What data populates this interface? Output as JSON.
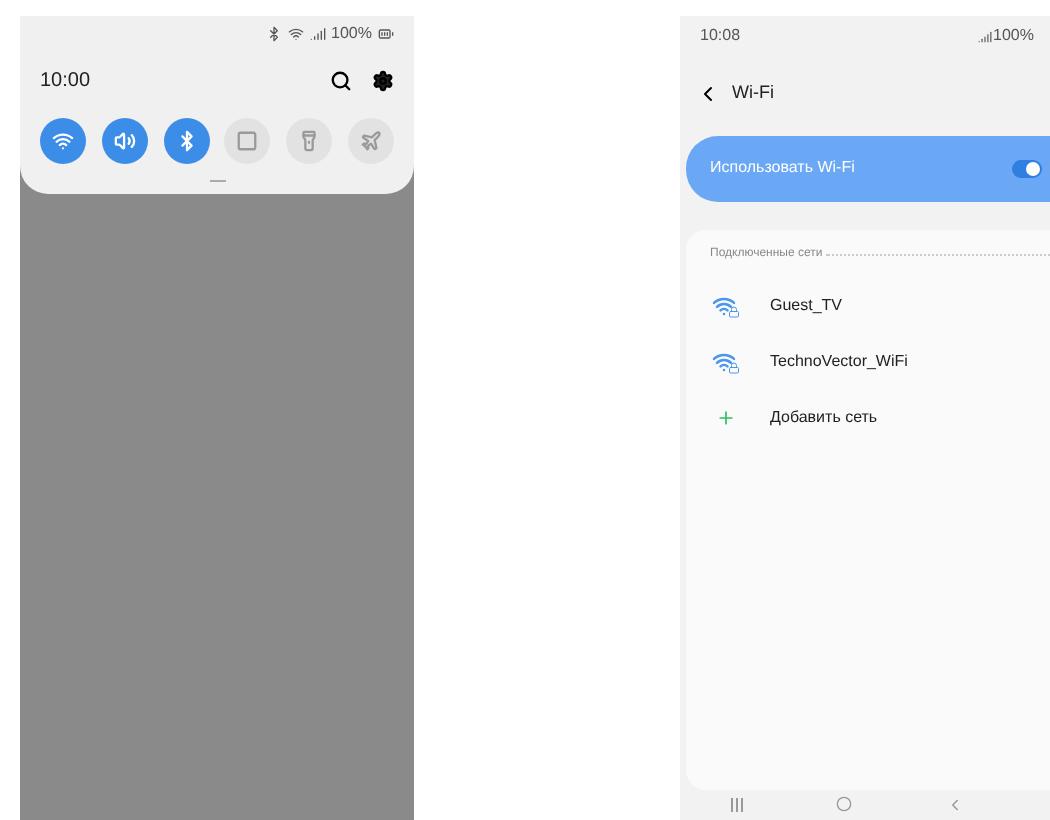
{
  "left_phone": {
    "status_bar": {
      "battery": "100%"
    },
    "clock": "10:00",
    "quick_toggles": [
      {
        "kind": "wifi",
        "on": true
      },
      {
        "kind": "sound",
        "on": true
      },
      {
        "kind": "bluetooth",
        "on": true
      },
      {
        "kind": "screen",
        "on": false
      },
      {
        "kind": "flashlight",
        "on": false
      },
      {
        "kind": "airplane",
        "on": false
      }
    ]
  },
  "right_phone": {
    "status_bar": {
      "time": "10:08",
      "battery": "100%"
    },
    "header": {
      "title": "Wi-Fi"
    },
    "wifi_switch": {
      "label": "Использовать Wi-Fi",
      "on": true
    },
    "section_title": "Подключенные сети",
    "networks": [
      {
        "kind": "network",
        "name": "Guest_TV"
      },
      {
        "kind": "network",
        "name": "TechnoVector_WiFi"
      },
      {
        "kind": "add",
        "name": "Добавить сеть"
      }
    ]
  }
}
